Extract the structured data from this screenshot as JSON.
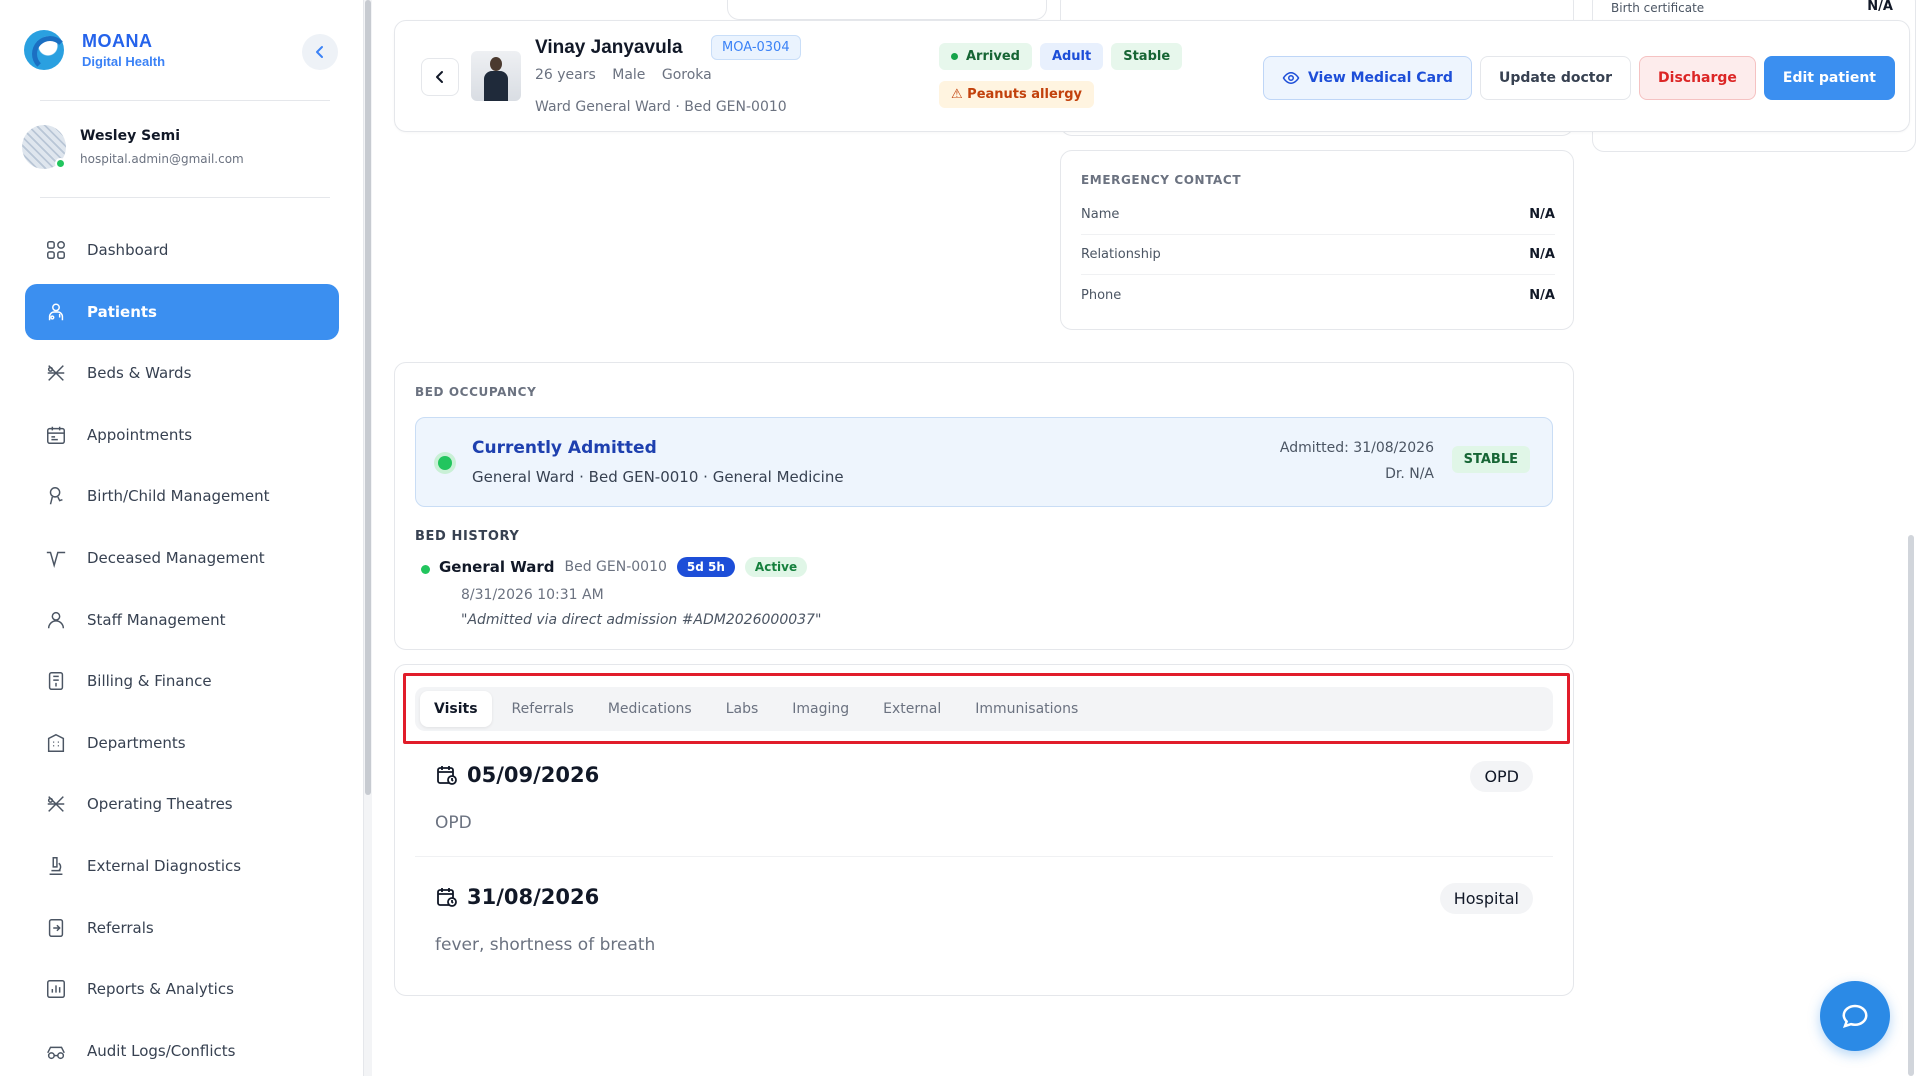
{
  "brand": {
    "name": "MOANA",
    "subtitle": "Digital Health"
  },
  "user": {
    "name": "Wesley Semi",
    "email": "hospital.admin@gmail.com"
  },
  "nav": [
    {
      "label": "Dashboard",
      "icon": "grid-icon"
    },
    {
      "label": "Patients",
      "icon": "patients-icon",
      "active": true
    },
    {
      "label": "Beds & Wards",
      "icon": "bed-icon"
    },
    {
      "label": "Appointments",
      "icon": "calendar-icon"
    },
    {
      "label": "Birth/Child Management",
      "icon": "baby-icon"
    },
    {
      "label": "Deceased Management",
      "icon": "pulse-icon"
    },
    {
      "label": "Staff Management",
      "icon": "staff-icon"
    },
    {
      "label": "Billing & Finance",
      "icon": "billing-icon"
    },
    {
      "label": "Departments",
      "icon": "departments-icon"
    },
    {
      "label": "Operating Theatres",
      "icon": "theatre-icon"
    },
    {
      "label": "External Diagnostics",
      "icon": "microscope-icon"
    },
    {
      "label": "Referrals",
      "icon": "referral-icon"
    },
    {
      "label": "Reports & Analytics",
      "icon": "reports-icon"
    },
    {
      "label": "Audit Logs/Conflicts",
      "icon": "audit-icon"
    }
  ],
  "patient": {
    "name": "Vinay Janyavula",
    "id": "MOA-0304",
    "age": "26 years",
    "sex": "Male",
    "location": "Goroka",
    "ward_bed": "Ward General Ward · Bed GEN-0010",
    "badges": {
      "arrived": "Arrived",
      "adult": "Adult",
      "stable": "Stable",
      "allergy": "⚠ Peanuts allergy"
    }
  },
  "actions": {
    "view": "View Medical Card",
    "update": "Update doctor",
    "discharge": "Discharge",
    "edit": "Edit patient"
  },
  "right_fragment": {
    "label": "Birth certificate",
    "value": "N/A"
  },
  "emergency": {
    "title": "EMERGENCY CONTACT",
    "rows": [
      {
        "label": "Name",
        "value": "N/A"
      },
      {
        "label": "Relationship",
        "value": "N/A"
      },
      {
        "label": "Phone",
        "value": "N/A"
      }
    ]
  },
  "bed": {
    "title": "BED OCCUPANCY",
    "current": {
      "title": "Currently Admitted",
      "detail": "General Ward · Bed GEN-0010 · General Medicine",
      "admitted": "Admitted: 31/08/2026",
      "doctor": "Dr. N/A",
      "status": "STABLE"
    },
    "history_title": "BED HISTORY",
    "history": {
      "ward": "General Ward",
      "bed": "Bed GEN-0010",
      "duration": "5d 5h",
      "state": "Active",
      "time": "8/31/2026 10:31 AM",
      "note": "\"Admitted via direct admission #ADM2026000037\""
    }
  },
  "tabs": [
    "Visits",
    "Referrals",
    "Medications",
    "Labs",
    "Imaging",
    "External",
    "Immunisations"
  ],
  "visits": [
    {
      "date": "05/09/2026",
      "type": "OPD",
      "reason": "OPD"
    },
    {
      "date": "31/08/2026",
      "type": "Hospital",
      "reason": "fever, shortness of breath"
    }
  ]
}
